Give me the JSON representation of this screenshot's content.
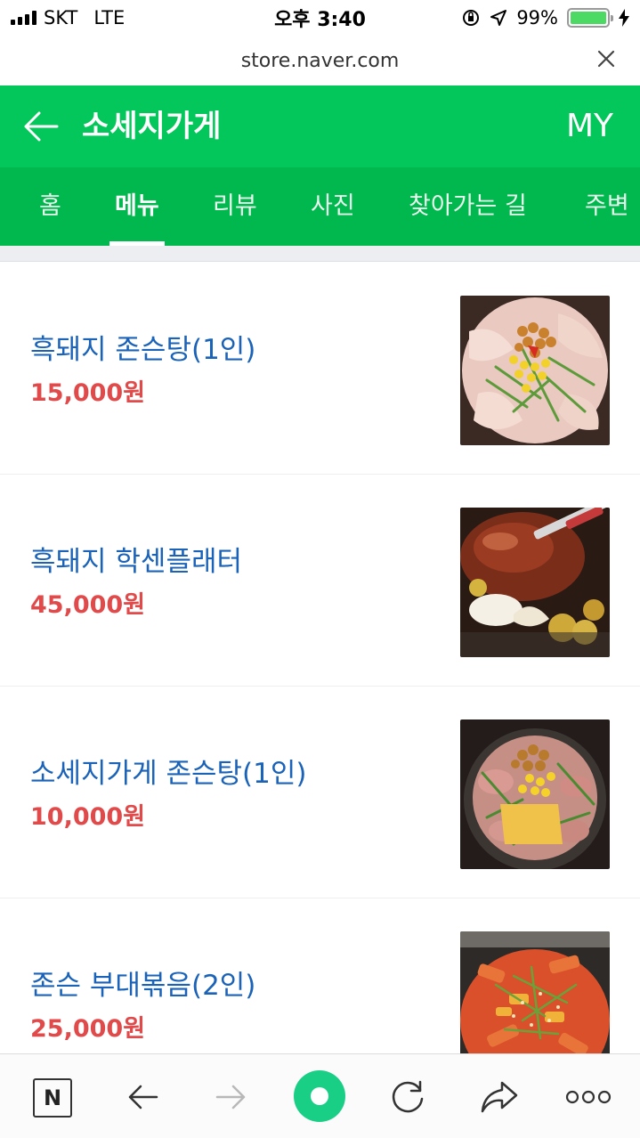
{
  "status_bar": {
    "carrier": "SKT",
    "network": "LTE",
    "time": "오후 3:40",
    "battery_percent": "99%",
    "battery_level": 0.99,
    "battery_color": "#4cd964"
  },
  "browser": {
    "url": "store.naver.com",
    "close_icon": "close-icon"
  },
  "header": {
    "back_icon": "back-arrow-icon",
    "store_name": "소세지가게",
    "my_label": "MY",
    "color": "#03c75a"
  },
  "tabs": [
    {
      "label": "홈",
      "active": false
    },
    {
      "label": "메뉴",
      "active": true
    },
    {
      "label": "리뷰",
      "active": false
    },
    {
      "label": "사진",
      "active": false
    },
    {
      "label": "찾아가는 길",
      "active": false
    },
    {
      "label": "주변",
      "active": false
    }
  ],
  "menu": {
    "items": [
      {
        "name": "흑돼지 존슨탕(1인)",
        "price": "15,000원",
        "photo_icon": "stew-photo"
      },
      {
        "name": "흑돼지 학센플래터",
        "price": "45,000원",
        "photo_icon": "roast-pork-photo"
      },
      {
        "name": "소세지가게 존슨탕(1인)",
        "price": "10,000원",
        "photo_icon": "stew-photo"
      },
      {
        "name": "존슨 부대볶음(2인)",
        "price": "25,000원",
        "photo_icon": "stir-fry-photo"
      }
    ],
    "name_color": "#1a63b8",
    "price_color": "#e14a4a"
  },
  "toolbar": {
    "naver_label": "N",
    "items": [
      "naver-home-icon",
      "back-icon",
      "forward-icon",
      "green-dot-button",
      "reload-icon",
      "share-icon",
      "more-icon"
    ]
  }
}
